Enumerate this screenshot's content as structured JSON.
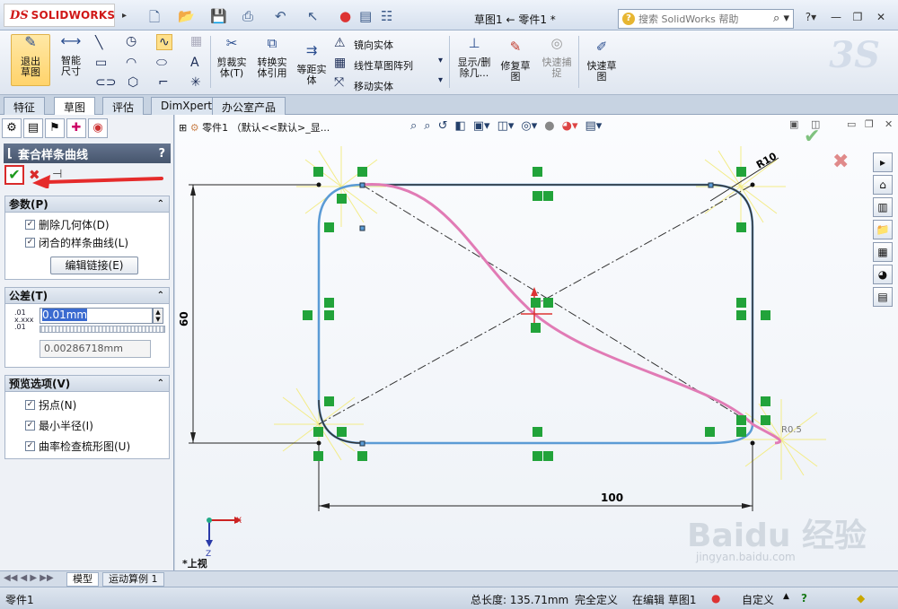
{
  "app": {
    "logo": "SOLIDWORKS",
    "title": "草图1 ← 零件1 *",
    "help_placeholder": "搜索 SolidWorks 帮助"
  },
  "cmd": {
    "exit_sketch": "退出草图",
    "smart_dim": "智能尺寸",
    "trim": "剪裁实体(T)",
    "convert": "转换实体引用",
    "offset": "等距实体",
    "mirror": "镜向实体",
    "linear_pattern": "线性草图阵列",
    "move": "移动实体",
    "display_delete": "显示/删除几...",
    "repair": "修复草图",
    "quick_snap": "快速捕捉",
    "rapid_sketch": "快速草图"
  },
  "tabs": [
    "特征",
    "草图",
    "评估",
    "DimXpert",
    "办公室产品"
  ],
  "panel": {
    "title": "套合样条曲线",
    "help": "?",
    "params_title": "参数(P)",
    "delete_geometry": "删除几何体(D)",
    "closed_spline": "闭合的样条曲线(L)",
    "edit_link": "编辑链接(E)",
    "tolerance_title": "公差(T)",
    "tolerance_value": "0.01mm",
    "tolerance_result": "0.00286718mm",
    "preview_title": "预览选项(V)",
    "inflection": "拐点(N)",
    "min_radius": "最小半径(I)",
    "curvature": "曲率检查梳形图(U)"
  },
  "canvas": {
    "tree_label": "零件1 （默认<<默认>_显...",
    "dim_r10": "R10",
    "dim_r05": "R0.5",
    "dim_60": "60",
    "dim_100": "100",
    "view_label": "*上视",
    "watermark": "Baidu 经验",
    "watermark_url": "jingyan.baidu.com",
    "axis_x": "X",
    "axis_z": "Z"
  },
  "sheets": [
    "模型",
    "运动算例 1"
  ],
  "status": {
    "doc": "零件1",
    "length": "总长度: 135.71mm",
    "defined": "完全定义",
    "editing": "在编辑 草图1",
    "custom": "自定义"
  },
  "colors": {
    "accent": "#d01818",
    "sketch_blue": "#5b9bd5",
    "spline_pink": "#e17bb5",
    "relation_green": "#22a33a"
  }
}
